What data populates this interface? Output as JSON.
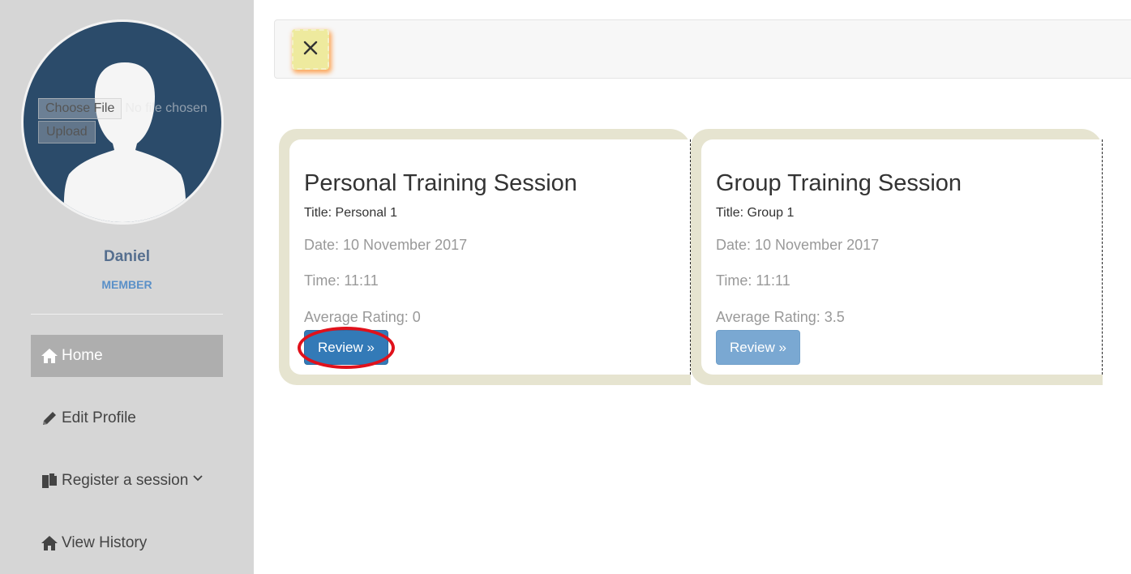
{
  "sidebar": {
    "file_input": {
      "button_label": "Choose File",
      "status_text": "No file chosen"
    },
    "upload_label": "Upload",
    "user": {
      "name": "Daniel",
      "role": "MEMBER"
    },
    "nav": [
      {
        "label": "Home",
        "icon": "home-icon",
        "active": true
      },
      {
        "label": "Edit Profile",
        "icon": "pencil-icon",
        "active": false
      },
      {
        "label": "Register a session",
        "icon": "documents-icon",
        "active": false,
        "has_dropdown": true
      },
      {
        "label": "View History",
        "icon": "home-icon",
        "active": false
      }
    ]
  },
  "toolbar": {
    "close_symbol": "×"
  },
  "cards": [
    {
      "heading": "Personal Training Session",
      "title": "Title: Personal 1",
      "date": "Date: 10 November 2017",
      "time": "Time: 11:11",
      "rating": "Average Rating: 0",
      "button_label": "Review »"
    },
    {
      "heading": "Group Training Session",
      "title": "Title: Group 1",
      "date": "Date: 10 November 2017",
      "time": "Time: 11:11",
      "rating": "Average Rating: 3.5",
      "button_label": "Review »"
    }
  ],
  "colors": {
    "sidebar_bg": "#d6d6d6",
    "avatar_bg": "#2b4b6a",
    "primary": "#337ab7",
    "card_border": "#e6e4d0",
    "highlight": "#e0111b"
  }
}
